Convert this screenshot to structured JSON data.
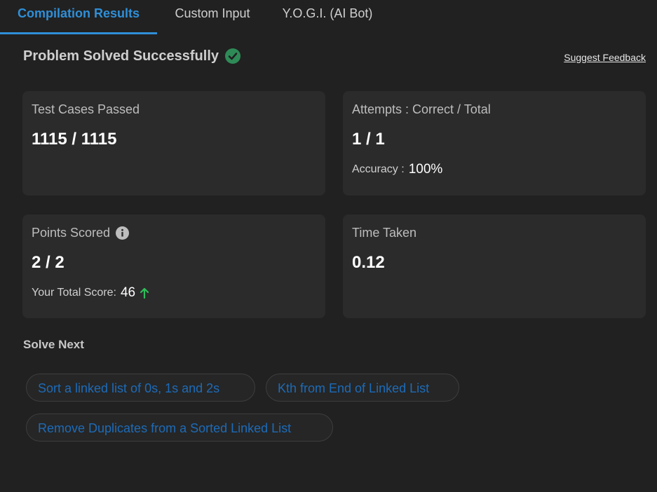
{
  "tabs": [
    {
      "label": "Compilation Results",
      "active": true
    },
    {
      "label": "Custom Input",
      "active": false
    },
    {
      "label": "Y.O.G.I. (AI Bot)",
      "active": false
    }
  ],
  "status": {
    "title": "Problem Solved Successfully",
    "icon": "check-circle-icon",
    "icon_color": "#2e8b57"
  },
  "feedback_link": "Suggest Feedback",
  "cards": {
    "test_cases": {
      "title": "Test Cases Passed",
      "value": "1115 / 1115"
    },
    "attempts": {
      "title": "Attempts : Correct / Total",
      "value": "1 / 1",
      "accuracy_label": "Accuracy :",
      "accuracy_value": "100%"
    },
    "points": {
      "title": "Points Scored",
      "value": "2 / 2",
      "total_label": "Your Total Score:",
      "total_value": "46",
      "trend_color": "#2ebd59"
    },
    "time": {
      "title": "Time Taken",
      "value": "0.12"
    }
  },
  "solve_next": {
    "heading": "Solve Next",
    "items": [
      "Sort a linked list of 0s, 1s and 2s",
      "Kth from End of Linked List",
      "Remove Duplicates from a Sorted Linked List"
    ]
  },
  "colors": {
    "accent": "#2f8fd8",
    "background": "#212121",
    "card": "#2b2b2b",
    "link_chip": "#1d6bb8"
  }
}
